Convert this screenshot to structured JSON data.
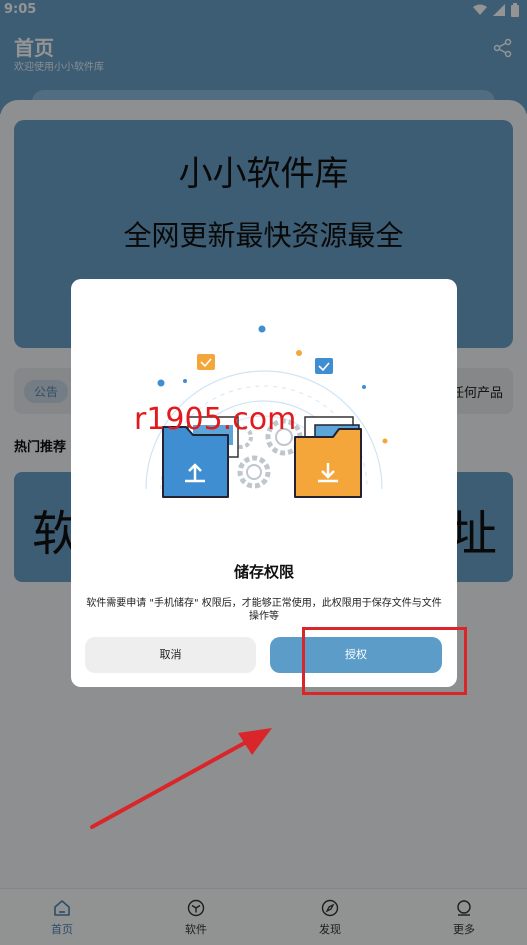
{
  "status_bar": {
    "time": "9:05"
  },
  "header": {
    "title": "首页",
    "subtitle": "欢迎使用小小软件库"
  },
  "banner": {
    "line1": "小小软件库",
    "line2": "全网更新最快资源最全"
  },
  "notice": {
    "badge": "公告",
    "text": "任何产品"
  },
  "section": {
    "title": "热门推荐"
  },
  "app_card": {
    "left_text": "软",
    "right_text": "址"
  },
  "tabs": [
    {
      "label": "首页",
      "icon": "home-icon",
      "active": true
    },
    {
      "label": "软件",
      "icon": "cube-icon",
      "active": false
    },
    {
      "label": "发现",
      "icon": "compass-icon",
      "active": false
    },
    {
      "label": "更多",
      "icon": "user-icon",
      "active": false
    }
  ],
  "dialog": {
    "title": "储存权限",
    "body": "软件需要申请 \"手机储存\" 权限后，才能够正常使用，此权限用于保存文件与文件操作等",
    "cancel_label": "取消",
    "confirm_label": "授权"
  },
  "watermark": "r1905.com",
  "colors": {
    "primary": "#6aa0c9",
    "button": "#5b9cc9",
    "highlight": "#d8262b"
  }
}
